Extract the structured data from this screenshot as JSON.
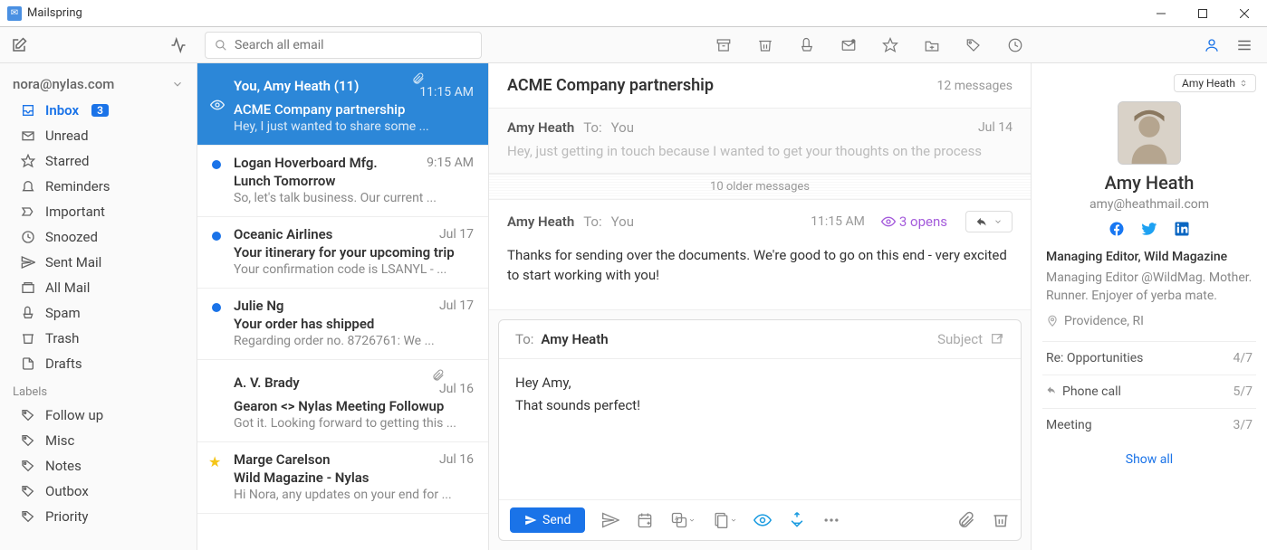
{
  "app": {
    "title": "Mailspring"
  },
  "search": {
    "placeholder": "Search all email"
  },
  "account": {
    "email": "nora@nylas.com"
  },
  "sidebar": {
    "items": [
      {
        "label": "Inbox",
        "badge": "3",
        "active": true
      },
      {
        "label": "Unread"
      },
      {
        "label": "Starred"
      },
      {
        "label": "Reminders"
      },
      {
        "label": "Important"
      },
      {
        "label": "Snoozed"
      },
      {
        "label": "Sent Mail"
      },
      {
        "label": "All Mail"
      },
      {
        "label": "Spam"
      },
      {
        "label": "Trash"
      },
      {
        "label": "Drafts"
      }
    ],
    "labels_header": "Labels",
    "labels": [
      {
        "label": "Follow up"
      },
      {
        "label": "Misc"
      },
      {
        "label": "Notes"
      },
      {
        "label": "Outbox"
      },
      {
        "label": "Priority"
      }
    ]
  },
  "messages": [
    {
      "from": "You, Amy Heath (11)",
      "time": "11:15 AM",
      "subject": "ACME Company partnership",
      "preview": "Hey, I just wanted to share some ...",
      "selected": true,
      "hasAttachment": true,
      "hasEye": true
    },
    {
      "from": "Logan Hoverboard Mfg.",
      "time": "9:15 AM",
      "subject": "Lunch Tomorrow",
      "preview": "So, let's talk business. Our current ...",
      "unread": true
    },
    {
      "from": "Oceanic Airlines",
      "time": "Jul 17",
      "subject": "Your itinerary for your upcoming trip",
      "preview": "Your confirmation code is LSANYL - ...",
      "unread": true
    },
    {
      "from": "Julie Ng",
      "time": "Jul 17",
      "subject": "Your order has shipped",
      "preview": "Regarding order no. 8726761: We ...",
      "unread": true
    },
    {
      "from": "A. V. Brady",
      "time": "Jul 16",
      "subject": "Gearon <> Nylas Meeting Followup",
      "preview": "Got it. Looking forward to getting this ...",
      "hasAttachment": true
    },
    {
      "from": "Marge Carelson",
      "time": "Jul 16",
      "subject": "Wild Magazine - Nylas",
      "preview": "Hi Nora, any updates on your end for ...",
      "starred": true
    }
  ],
  "thread": {
    "subject": "ACME Company partnership",
    "count": "12 messages",
    "older": "10 older messages",
    "msg1": {
      "sender": "Amy Heath",
      "to": "To:",
      "to_who": "You",
      "date": "Jul 14",
      "body": "Hey, just getting in touch because I wanted to get your thoughts on the process"
    },
    "msg2": {
      "sender": "Amy Heath",
      "to": "To:",
      "to_who": "You",
      "date": "11:15 AM",
      "opens": "3 opens",
      "body": "Thanks for sending over the documents. We're good to go on this end - very excited to start working with you!"
    }
  },
  "composer": {
    "to_label": "To:",
    "to_name": "Amy Heath",
    "subject_label": "Subject",
    "body_line1": "Hey Amy,",
    "body_line2": "That sounds perfect!",
    "send": "Send"
  },
  "contact": {
    "selector": "Amy Heath",
    "name": "Amy Heath",
    "email": "amy@heathmail.com",
    "title": "Managing Editor, Wild Magazine",
    "bio": "Managing Editor @WildMag. Mother. Runner. Enjoyer of yerba mate.",
    "location": "Providence, RI",
    "related": [
      {
        "label": "Re: Opportunities",
        "meta": "4/7"
      },
      {
        "label": "Phone call",
        "meta": "5/7",
        "reply": true
      },
      {
        "label": "Meeting",
        "meta": "3/7"
      }
    ],
    "show_all": "Show all"
  }
}
